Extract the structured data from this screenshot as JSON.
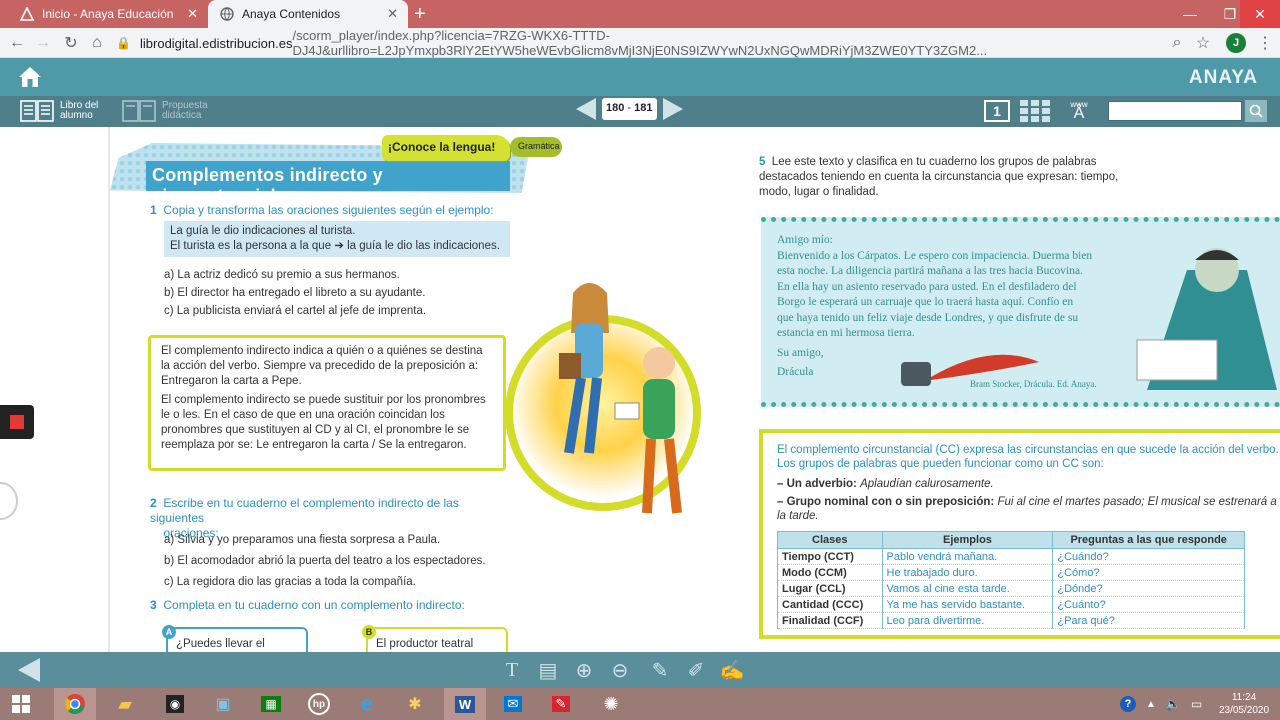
{
  "browser": {
    "tabs": [
      {
        "title": "Inicio - Anaya Educación",
        "active": false
      },
      {
        "title": "Anaya Contenidos",
        "active": true
      }
    ],
    "url_host": "librodigital.edistribucion.es",
    "url_path": "/scorm_player/index.php?licencia=7RZG-WKX6-TTTD-DJ4J&urllibro=L2JpYmxpb3RlY2EtYW5heWEvbGlicm8vMjI3NjE0NS9IZWYwN2UxNGQwMDRiYjM3ZWE0YTY3ZGM2...",
    "profile_initial": "J"
  },
  "app": {
    "brand": "ANAYA",
    "libro_alumno": "Libro del alumno",
    "propuesta": "Propuesta didáctica",
    "page_current": "180",
    "page_next": "181",
    "view_single": "1",
    "www": "www"
  },
  "left_page": {
    "tag_conoce": "¡Conoce la lengua!",
    "tag_gramatica": "Gramática",
    "title": "Complementos indirecto y circunstancial",
    "ex1": {
      "num": "1",
      "instruction": "Copia y transforma las oraciones siguientes según el ejemplo:",
      "example_line1": "La guía le dio indicaciones al turista.",
      "example_line2": "El turista es la persona a la que ➔ la guía le dio las indicaciones.",
      "items": [
        "a) La actriz dedicó su premio a sus hermanos.",
        "b) El director ha entregado el libreto a su ayudante.",
        "c) La publicista enviará el cartel al jefe de imprenta."
      ]
    },
    "grammar": {
      "p1": "El complemento indirecto indica a quién o a quiénes se destina la acción del verbo. Siempre va precedido de la preposición a: Entregaron la carta a Pepe.",
      "p2": "El complemento indirecto se puede sustituir por los pronombres le o les. En el caso de que en una oración coincidan los pronombres que sustituyen al CD y al CI, el pronombre le se reemplaza por se: Le entregaron la carta / Se la entregaron."
    },
    "ex2": {
      "num": "2",
      "instruction_l1": "Escribe en tu cuaderno el complemento indirecto de las siguientes",
      "instruction_l2": "oraciones:",
      "items": [
        "a) Silvia y yo preparamos una fiesta sorpresa a Paula.",
        "b) El acomodador abrió la puerta del teatro a los espectadores.",
        "c) La regidora dio las gracias a toda la compañía."
      ]
    },
    "ex3": {
      "num": "3",
      "instruction": "Completa en tu cuaderno con un complemento indirecto:",
      "box_a_badge": "A",
      "box_a": "¿Puedes llevar el",
      "box_b_badge": "B",
      "box_b": "El productor teatral"
    }
  },
  "right_page": {
    "ex5": {
      "num": "5",
      "instruction": "Lee este texto y clasifica en tu cuaderno los grupos de palabras destacados teniendo en cuenta la circunstancia que expresan: tiempo, modo, lugar o finalidad."
    },
    "letter": {
      "greeting": "Amigo mío:",
      "body": [
        "Bienvenido a los Cárpatos. Le espero con impaciencia. Duerma bien",
        "esta noche. La diligencia partirá mañana a las tres hacia Bucovina.",
        "En ella hay un asiento reservado para usted. En el desfiladero del",
        "Borgo le esperará un carruaje que lo traerá hasta aquí. Confío en",
        "que haya tenido un feliz viaje desde Londres, y que disfrute de su",
        "estancia en mi hermosa tierra."
      ],
      "closing": "Su amigo,",
      "signature": "Drácula",
      "credit": "Bram Stocker, Drácula. Ed. Anaya."
    },
    "cc": {
      "intro": "El complemento circunstancial (CC) expresa las circunstancias en que sucede la acción del verbo. Los grupos de palabras que pueden funcionar como un CC son:",
      "bullet1_label": "– Un adverbio:",
      "bullet1_example": "Aplaudían calurosamente.",
      "bullet2_label": "– Grupo nominal con o sin preposición:",
      "bullet2_example": "Fui al cine el martes pasado; El musical se estrenará a la tarde.",
      "table": {
        "headers": [
          "Clases",
          "Ejemplos",
          "Preguntas a las que responde"
        ],
        "rows": [
          [
            "Tiempo (CCT)",
            "Pablo vendrá mañana.",
            "¿Cuándo?"
          ],
          [
            "Modo (CCM)",
            "He trabajado duro.",
            "¿Cómo?"
          ],
          [
            "Lugar (CCL)",
            "Vamos al cine esta tarde.",
            "¿Dónde?"
          ],
          [
            "Cantidad (CCC)",
            "Ya me has servido bastante.",
            "¿Cuánto?"
          ],
          [
            "Finalidad (CCF)",
            "Leo para divertirme.",
            "¿Para qué?"
          ]
        ]
      }
    }
  },
  "taskbar": {
    "time": "11:24",
    "date": "23/05/2020"
  },
  "colors": {
    "tabstrip": "#c66463",
    "app_header": "#4f9aa8",
    "app_bar": "#4f7f8b",
    "accent_blue": "#2e8fc3",
    "accent_lime": "#d4dc2a",
    "taskbar": "#9a7b76"
  }
}
